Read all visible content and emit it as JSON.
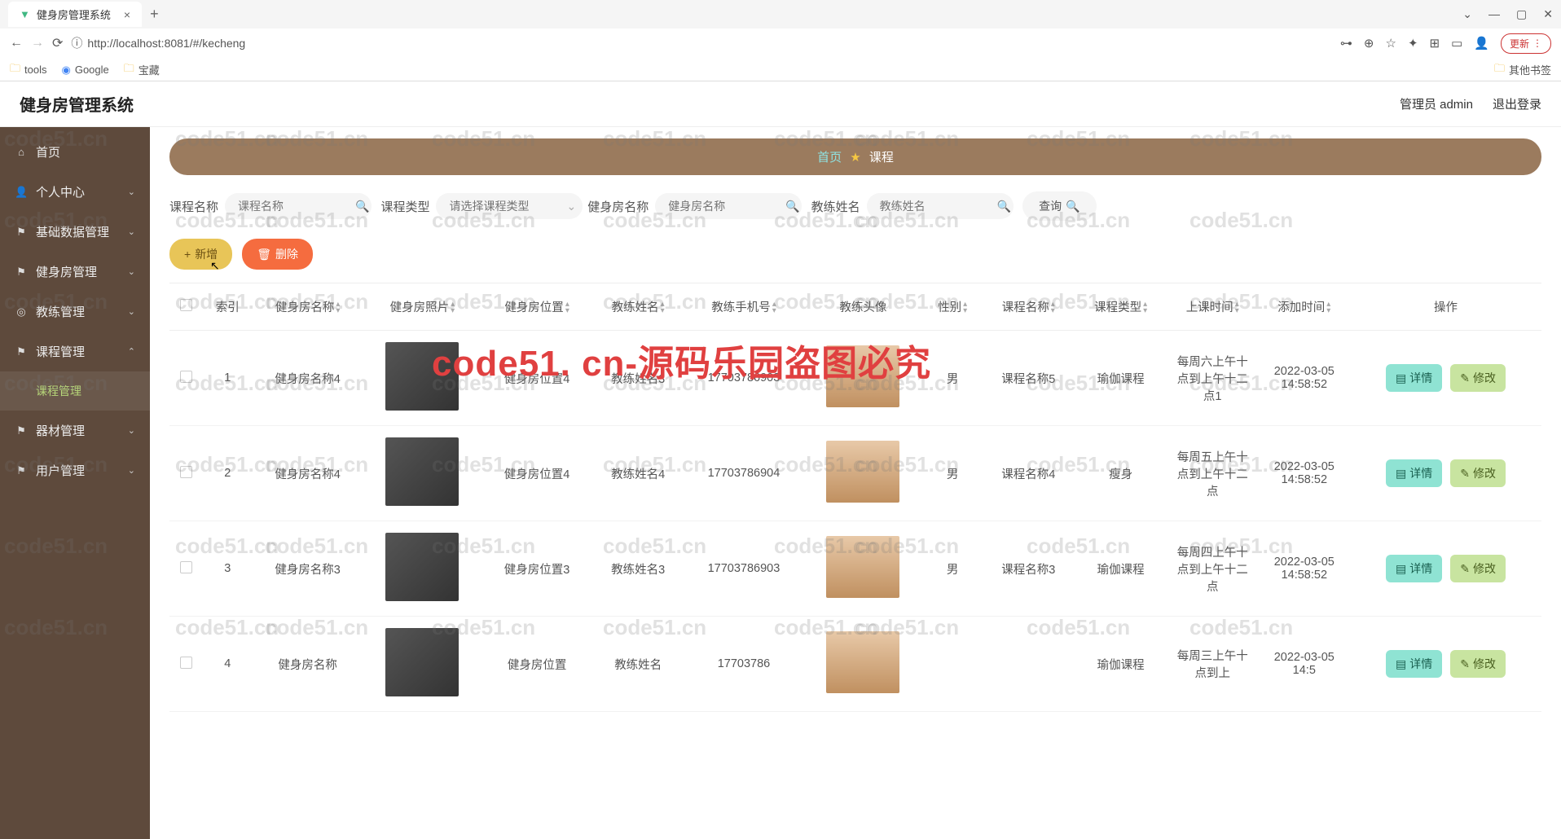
{
  "browser": {
    "tab_title": "健身房管理系统",
    "url": "http://localhost:8081/#/kecheng",
    "update": "更新",
    "bookmarks": {
      "tools": "tools",
      "google": "Google",
      "baocang": "宝藏",
      "other": "其他书签"
    }
  },
  "header": {
    "app_title": "健身房管理系统",
    "admin_label": "管理员 admin",
    "logout": "退出登录"
  },
  "sidebar": {
    "items": [
      {
        "icon": "home",
        "label": "首页"
      },
      {
        "icon": "user",
        "label": "个人中心",
        "caret": true
      },
      {
        "icon": "flag",
        "label": "基础数据管理",
        "caret": true
      },
      {
        "icon": "flag",
        "label": "健身房管理",
        "caret": true
      },
      {
        "icon": "medal",
        "label": "教练管理",
        "caret": true
      },
      {
        "icon": "flag",
        "label": "课程管理",
        "caret": true,
        "expanded": true
      },
      {
        "sub": true,
        "label": "课程管理"
      },
      {
        "icon": "flag",
        "label": "器材管理",
        "caret": true
      },
      {
        "icon": "flag",
        "label": "用户管理",
        "caret": true
      }
    ]
  },
  "breadcrumb": {
    "home": "首页",
    "current": "课程"
  },
  "search": {
    "name_label": "课程名称",
    "name_ph": "课程名称",
    "type_label": "课程类型",
    "type_ph": "请选择课程类型",
    "gym_label": "健身房名称",
    "gym_ph": "健身房名称",
    "coach_label": "教练姓名",
    "coach_ph": "教练姓名",
    "query": "查询"
  },
  "actions": {
    "add": "新增",
    "delete": "删除"
  },
  "table": {
    "cols": [
      "索引",
      "健身房名称",
      "健身房照片",
      "健身房位置",
      "教练姓名",
      "教练手机号",
      "教练头像",
      "性别",
      "课程名称",
      "课程类型",
      "上课时间",
      "添加时间",
      "操作"
    ],
    "detail": "详情",
    "edit": "修改",
    "rows": [
      {
        "idx": "1",
        "gym": "健身房名称4",
        "loc": "健身房位置4",
        "coach": "教练姓名3",
        "phone": "17703786903",
        "gender": "男",
        "course": "课程名称5",
        "ctype": "瑜伽课程",
        "time": "每周六上午十点到上午十二点1",
        "added": "2022-03-05 14:58:52"
      },
      {
        "idx": "2",
        "gym": "健身房名称4",
        "loc": "健身房位置4",
        "coach": "教练姓名4",
        "phone": "17703786904",
        "gender": "男",
        "course": "课程名称4",
        "ctype": "瘦身",
        "time": "每周五上午十点到上午十二点",
        "added": "2022-03-05 14:58:52"
      },
      {
        "idx": "3",
        "gym": "健身房名称3",
        "loc": "健身房位置3",
        "coach": "教练姓名3",
        "phone": "17703786903",
        "gender": "男",
        "course": "课程名称3",
        "ctype": "瑜伽课程",
        "time": "每周四上午十点到上午十二点",
        "added": "2022-03-05 14:58:52"
      },
      {
        "idx": "4",
        "gym": "健身房名称",
        "loc": "健身房位置",
        "coach": "教练姓名",
        "phone": "17703786",
        "gender": "",
        "course": "",
        "ctype": "瑜伽课程",
        "time": "每周三上午十点到上",
        "added": "2022-03-05 14:5"
      }
    ]
  },
  "watermark": "code51. cn-源码乐园盗图必究",
  "wm_small": "code51.cn"
}
